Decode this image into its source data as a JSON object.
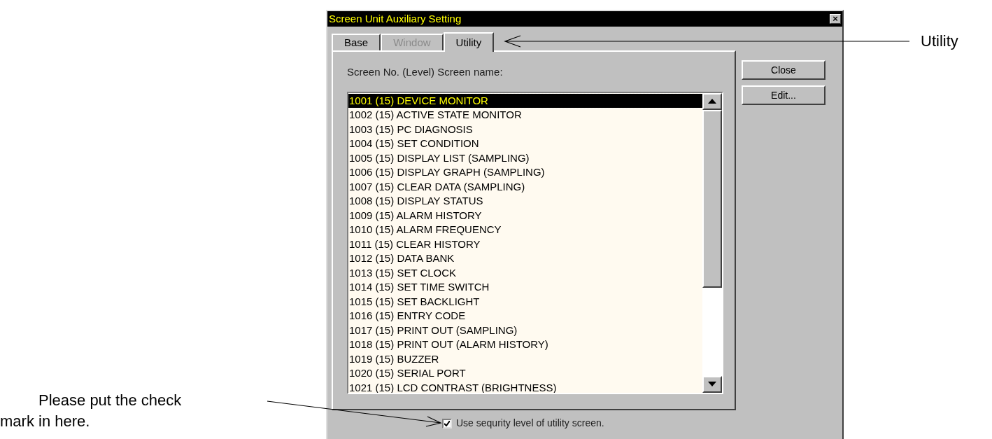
{
  "window": {
    "title": "Screen Unit Auxiliary Setting",
    "close": "×"
  },
  "tabs": [
    {
      "label": "Base",
      "selected": false,
      "disabled": false
    },
    {
      "label": "Window",
      "selected": false,
      "disabled": true
    },
    {
      "label": "Utility",
      "selected": true,
      "disabled": false
    }
  ],
  "list_label": "Screen No. (Level) Screen name:",
  "list": [
    {
      "text": "1001 (15) DEVICE MONITOR",
      "selected": true
    },
    {
      "text": "1002 (15) ACTIVE STATE MONITOR",
      "selected": false
    },
    {
      "text": "1003 (15) PC DIAGNOSIS",
      "selected": false
    },
    {
      "text": "1004 (15) SET CONDITION",
      "selected": false
    },
    {
      "text": "1005 (15) DISPLAY LIST (SAMPLING)",
      "selected": false
    },
    {
      "text": "1006 (15) DISPLAY GRAPH (SAMPLING)",
      "selected": false
    },
    {
      "text": "1007 (15) CLEAR DATA (SAMPLING)",
      "selected": false
    },
    {
      "text": "1008 (15) DISPLAY STATUS",
      "selected": false
    },
    {
      "text": "1009 (15) ALARM HISTORY",
      "selected": false
    },
    {
      "text": "1010 (15) ALARM FREQUENCY",
      "selected": false
    },
    {
      "text": "1011 (15) CLEAR HISTORY",
      "selected": false
    },
    {
      "text": "1012 (15) DATA BANK",
      "selected": false
    },
    {
      "text": "1013 (15) SET CLOCK",
      "selected": false
    },
    {
      "text": "1014 (15) SET TIME SWITCH",
      "selected": false
    },
    {
      "text": "1015 (15) SET BACKLIGHT",
      "selected": false
    },
    {
      "text": "1016 (15) ENTRY CODE",
      "selected": false
    },
    {
      "text": "1017 (15) PRINT OUT (SAMPLING)",
      "selected": false
    },
    {
      "text": "1018 (15) PRINT OUT (ALARM HISTORY)",
      "selected": false
    },
    {
      "text": "1019 (15) BUZZER",
      "selected": false
    },
    {
      "text": "1020 (15) SERIAL PORT",
      "selected": false
    },
    {
      "text": "1021 (15) LCD CONTRAST (BRIGHTNESS)",
      "selected": false
    }
  ],
  "buttons": [
    "Close",
    "Edit..."
  ],
  "checkbox": {
    "label": "Use sequrity level of utility screen.",
    "checked": true
  },
  "annotations": {
    "left": [
      "Please put the check",
      "mark in here."
    ],
    "right": "Utility"
  }
}
